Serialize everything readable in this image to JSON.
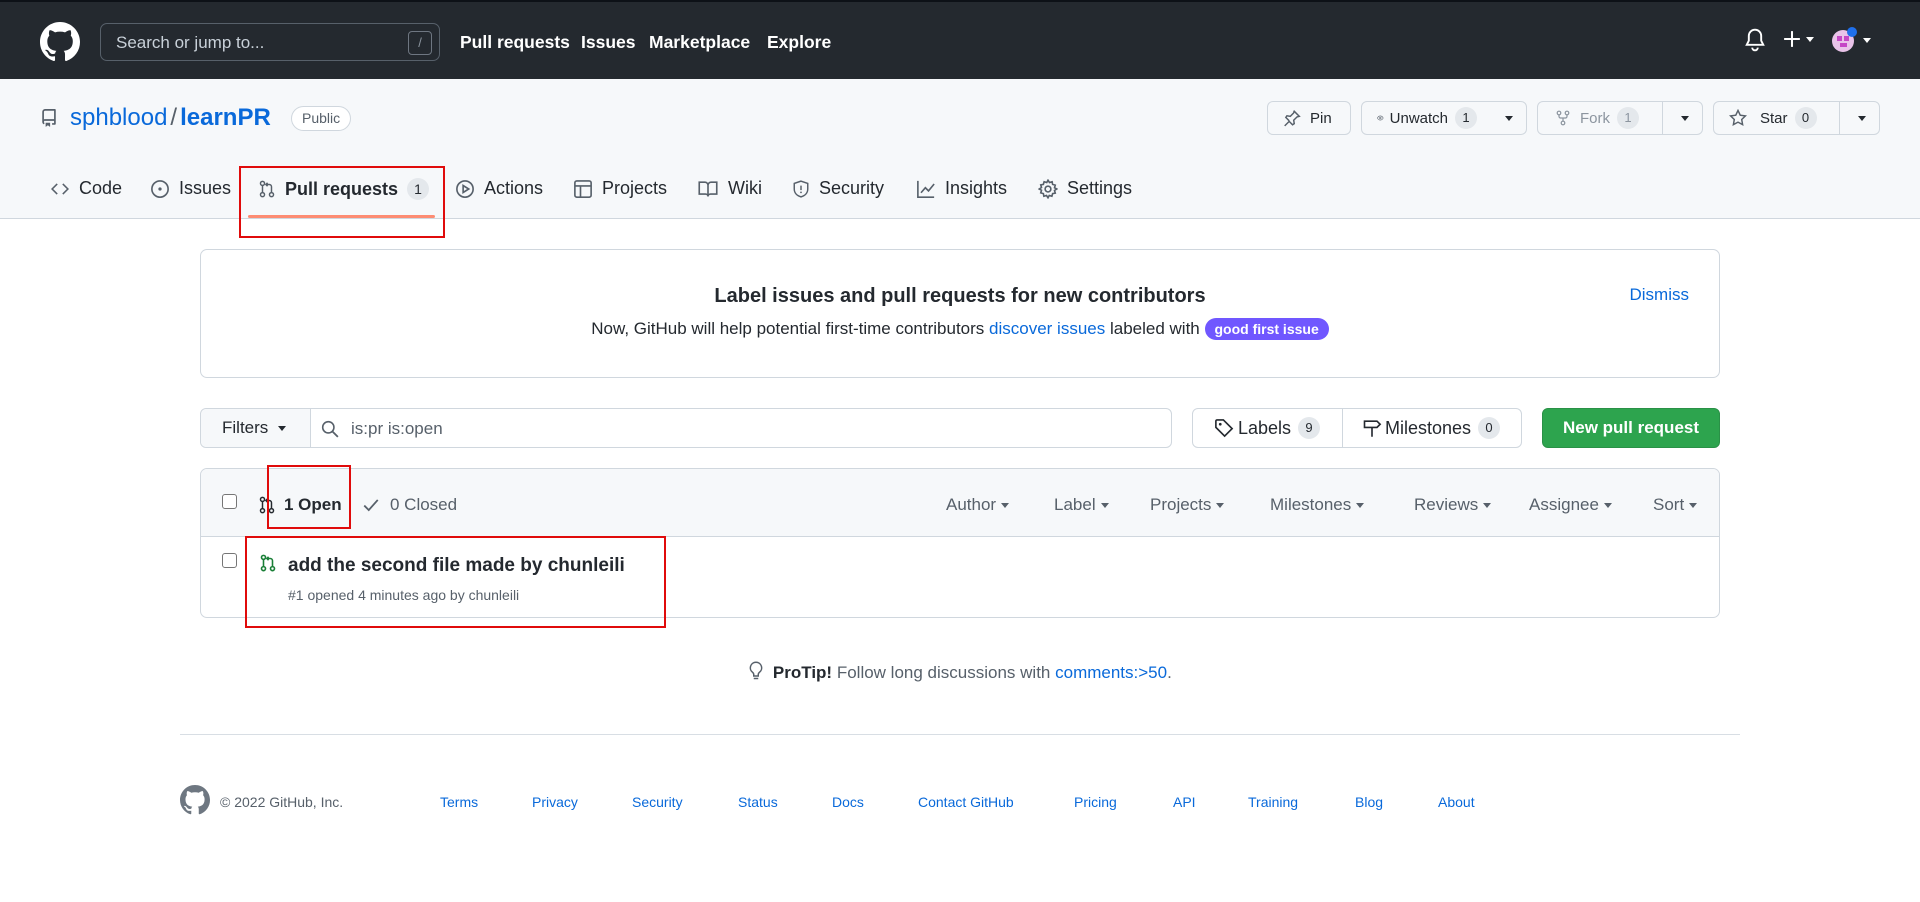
{
  "header": {
    "search_placeholder": "Search or jump to...",
    "search_shortcut": "/",
    "nav": [
      "Pull requests",
      "Issues",
      "Marketplace",
      "Explore"
    ]
  },
  "repo": {
    "owner": "sphblood",
    "separator": "/",
    "name": "learnPR",
    "visibility": "Public",
    "pin_label": "Pin",
    "unwatch_label": "Unwatch",
    "watch_count": "1",
    "fork_label": "Fork",
    "fork_count": "1",
    "star_label": "Star",
    "star_count": "0"
  },
  "tabs": {
    "code": "Code",
    "issues": "Issues",
    "pulls": "Pull requests",
    "pulls_count": "1",
    "actions": "Actions",
    "projects": "Projects",
    "wiki": "Wiki",
    "security": "Security",
    "insights": "Insights",
    "settings": "Settings"
  },
  "banner": {
    "title": "Label issues and pull requests for new contributors",
    "desc_prefix": "Now, GitHub will help potential first-time contributors",
    "desc_link": "discover issues",
    "desc_suffix": "labeled with",
    "label": "good first issue",
    "dismiss": "Dismiss"
  },
  "filters": {
    "button": "Filters",
    "query": "is:pr is:open",
    "labels": "Labels",
    "labels_count": "9",
    "milestones": "Milestones",
    "milestones_count": "0",
    "new_pr": "New pull request"
  },
  "list": {
    "open": "1 Open",
    "closed": "0 Closed",
    "menus": [
      "Author",
      "Label",
      "Projects",
      "Milestones",
      "Reviews",
      "Assignee",
      "Sort"
    ],
    "items": [
      {
        "title": "add the second file made by chunleili",
        "meta": "#1 opened 4 minutes ago by chunleili"
      }
    ]
  },
  "protip": {
    "label": "ProTip!",
    "text": "Follow long discussions with",
    "link": "comments:>50",
    "end": "."
  },
  "footer": {
    "copyright": "© 2022 GitHub, Inc.",
    "links": [
      "Terms",
      "Privacy",
      "Security",
      "Status",
      "Docs",
      "Contact GitHub",
      "Pricing",
      "API",
      "Training",
      "Blog",
      "About"
    ]
  },
  "colors": {
    "header_bg": "#24292f",
    "link": "#0969da",
    "primary_green": "#2da44e",
    "tab_underline": "#fd8c73",
    "label_purple": "#7057ff",
    "highlight_red": "#e00b0b"
  }
}
